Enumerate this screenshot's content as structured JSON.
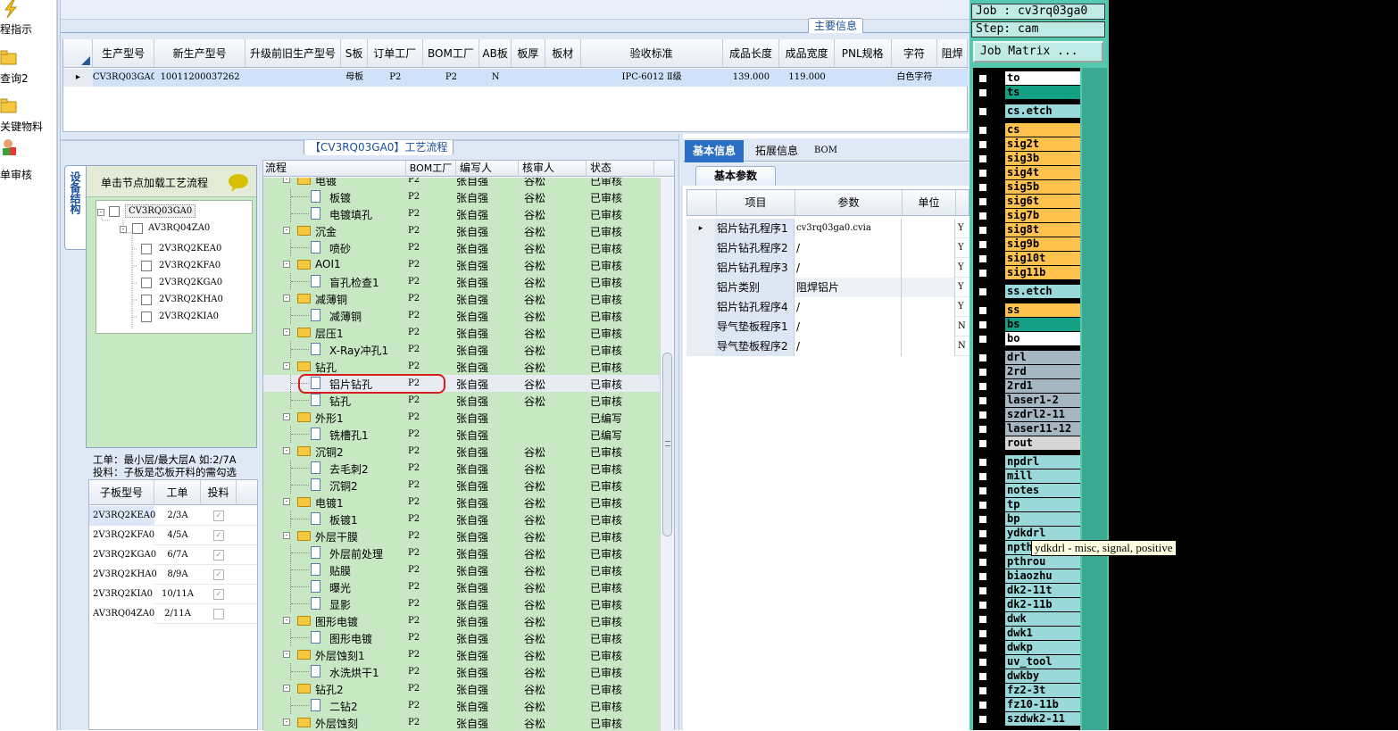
{
  "left_nav": {
    "items": [
      {
        "label": "程指示"
      },
      {
        "label": "查询2"
      },
      {
        "label": "关键物料"
      },
      {
        "label": "单审核"
      }
    ]
  },
  "top_panel": {
    "title": "主要信息",
    "columns": [
      "生产型号",
      "新生产型号",
      "升级前旧生产型号",
      "S板",
      "订单工厂",
      "BOM工厂",
      "AB板",
      "板厚",
      "板材",
      "验收标准",
      "成品长度",
      "成品宽度",
      "PNL规格",
      "字符",
      "阻焊"
    ],
    "row": [
      "CV3RQ03GA0",
      "10011200037262",
      "",
      "母板",
      "P2",
      "P2",
      "N",
      "",
      "",
      "IPC-6012 Ⅱ级",
      "139.000",
      "119.000",
      "",
      "白色字符",
      ""
    ]
  },
  "flow_panel": {
    "title": "【CV3RQ03GA0】工艺流程",
    "side_tab": "设备结构"
  },
  "node_panel": {
    "hint": "单击节点加载工艺流程",
    "tree": [
      "CV3RQ03GA0",
      "AV3RQ04ZA0",
      "2V3RQ2KEA0",
      "2V3RQ2KFA0",
      "2V3RQ2KGA0",
      "2V3RQ2KHA0",
      "2V3RQ2KIA0"
    ],
    "note1": "工单：最小层/最大层A 如:2/7A",
    "note2": "投料：子板是芯板开料的需勾选"
  },
  "sub_table": {
    "columns": [
      "子板型号",
      "工单",
      "投料"
    ],
    "rows": [
      [
        "2V3RQ2KEA0",
        "2/3A",
        true
      ],
      [
        "2V3RQ2KFA0",
        "4/5A",
        true
      ],
      [
        "2V3RQ2KGA0",
        "6/7A",
        true
      ],
      [
        "2V3RQ2KHA0",
        "8/9A",
        true
      ],
      [
        "2V3RQ2KIA0",
        "10/11A",
        true
      ],
      [
        "AV3RQ04ZA0",
        "2/11A",
        false
      ]
    ]
  },
  "flow_grid": {
    "columns": [
      "流程",
      "BOM工厂",
      "编写人",
      "核审人",
      "状态"
    ],
    "rows": [
      {
        "name": "电镀",
        "type": "folder",
        "bom": "P2",
        "writer": "张自强",
        "checker": "谷松",
        "status": "已审核"
      },
      {
        "name": "板镀",
        "type": "doc",
        "bom": "P2",
        "writer": "张自强",
        "checker": "谷松",
        "status": "已审核"
      },
      {
        "name": "电镀填孔",
        "type": "doc",
        "bom": "P2",
        "writer": "张自强",
        "checker": "谷松",
        "status": "已审核"
      },
      {
        "name": "沉金",
        "type": "folder",
        "bom": "P2",
        "writer": "张自强",
        "checker": "谷松",
        "status": "已审核"
      },
      {
        "name": "喷砂",
        "type": "doc",
        "bom": "P2",
        "writer": "张自强",
        "checker": "谷松",
        "status": "已审核"
      },
      {
        "name": "AOI1",
        "type": "folder",
        "bom": "P2",
        "writer": "张自强",
        "checker": "谷松",
        "status": "已审核"
      },
      {
        "name": "盲孔检查1",
        "type": "doc",
        "bom": "P2",
        "writer": "张自强",
        "checker": "谷松",
        "status": "已审核"
      },
      {
        "name": "减薄铜",
        "type": "folder",
        "bom": "P2",
        "writer": "张自强",
        "checker": "谷松",
        "status": "已审核"
      },
      {
        "name": "减薄铜",
        "type": "doc",
        "bom": "P2",
        "writer": "张自强",
        "checker": "谷松",
        "status": "已审核"
      },
      {
        "name": "层压1",
        "type": "folder",
        "bom": "P2",
        "writer": "张自强",
        "checker": "谷松",
        "status": "已审核"
      },
      {
        "name": "X-Ray冲孔1",
        "type": "doc",
        "bom": "P2",
        "writer": "张自强",
        "checker": "谷松",
        "status": "已审核"
      },
      {
        "name": "钻孔",
        "type": "folder",
        "bom": "P2",
        "writer": "张自强",
        "checker": "谷松",
        "status": "已审核"
      },
      {
        "name": "铝片钻孔",
        "type": "doc",
        "bom": "P2",
        "writer": "张自强",
        "checker": "谷松",
        "status": "已审核",
        "selected": true
      },
      {
        "name": "钻孔",
        "type": "doc",
        "bom": "P2",
        "writer": "张自强",
        "checker": "谷松",
        "status": "已审核"
      },
      {
        "name": "外形1",
        "type": "folder",
        "bom": "P2",
        "writer": "张自强",
        "checker": "",
        "status": "已编写"
      },
      {
        "name": "铣槽孔1",
        "type": "doc",
        "bom": "P2",
        "writer": "张自强",
        "checker": "",
        "status": "已编写"
      },
      {
        "name": "沉铜2",
        "type": "folder",
        "bom": "P2",
        "writer": "张自强",
        "checker": "谷松",
        "status": "已审核"
      },
      {
        "name": "去毛刺2",
        "type": "doc",
        "bom": "P2",
        "writer": "张自强",
        "checker": "谷松",
        "status": "已审核"
      },
      {
        "name": "沉铜2",
        "type": "doc",
        "bom": "P2",
        "writer": "张自强",
        "checker": "谷松",
        "status": "已审核"
      },
      {
        "name": "电镀1",
        "type": "folder",
        "bom": "P2",
        "writer": "张自强",
        "checker": "谷松",
        "status": "已审核"
      },
      {
        "name": "板镀1",
        "type": "doc",
        "bom": "P2",
        "writer": "张自强",
        "checker": "谷松",
        "status": "已审核"
      },
      {
        "name": "外层干膜",
        "type": "folder",
        "bom": "P2",
        "writer": "张自强",
        "checker": "谷松",
        "status": "已审核"
      },
      {
        "name": "外层前处理",
        "type": "doc",
        "bom": "P2",
        "writer": "张自强",
        "checker": "谷松",
        "status": "已审核"
      },
      {
        "name": "贴膜",
        "type": "doc",
        "bom": "P2",
        "writer": "张自强",
        "checker": "谷松",
        "status": "已审核"
      },
      {
        "name": "曝光",
        "type": "doc",
        "bom": "P2",
        "writer": "张自强",
        "checker": "谷松",
        "status": "已审核"
      },
      {
        "name": "显影",
        "type": "doc",
        "bom": "P2",
        "writer": "张自强",
        "checker": "谷松",
        "status": "已审核"
      },
      {
        "name": "图形电镀",
        "type": "folder",
        "bom": "P2",
        "writer": "张自强",
        "checker": "谷松",
        "status": "已审核"
      },
      {
        "name": "图形电镀",
        "type": "doc",
        "bom": "P2",
        "writer": "张自强",
        "checker": "谷松",
        "status": "已审核"
      },
      {
        "name": "外层蚀刻1",
        "type": "folder",
        "bom": "P2",
        "writer": "张自强",
        "checker": "谷松",
        "status": "已审核"
      },
      {
        "name": "水洗烘干1",
        "type": "doc",
        "bom": "P2",
        "writer": "张自强",
        "checker": "谷松",
        "status": "已审核"
      },
      {
        "name": "钻孔2",
        "type": "folder",
        "bom": "P2",
        "writer": "张自强",
        "checker": "谷松",
        "status": "已审核"
      },
      {
        "name": "二钻2",
        "type": "doc",
        "bom": "P2",
        "writer": "张自强",
        "checker": "谷松",
        "status": "已审核"
      },
      {
        "name": "外层蚀刻",
        "type": "folder",
        "bom": "P2",
        "writer": "张自强",
        "checker": "谷松",
        "status": "已审核"
      }
    ]
  },
  "info_panel": {
    "tabs": [
      "基本信息",
      "拓展信息",
      "BOM"
    ],
    "subtab": "基本参数",
    "columns": [
      "项目",
      "参数",
      "单位"
    ],
    "rows": [
      [
        "铝片钻孔程序1",
        "cv3rq03ga0.cvia",
        "",
        "Y"
      ],
      [
        "铝片钻孔程序2",
        "/",
        "",
        "Y"
      ],
      [
        "铝片钻孔程序3",
        "/",
        "",
        "Y"
      ],
      [
        "铝片类别",
        "阻焊铝片",
        "",
        "Y"
      ],
      [
        "铝片钻孔程序4",
        "/",
        "",
        "Y"
      ],
      [
        "导气垫板程序1",
        "/",
        "",
        "N"
      ],
      [
        "导气垫板程序2",
        "/",
        "",
        "N"
      ]
    ]
  },
  "job_matrix": {
    "job": "Job : cv3rq03ga0",
    "step": "Step: cam",
    "button": "Job Matrix ...",
    "layers": [
      {
        "name": "to",
        "color": "#ffffff"
      },
      {
        "name": "ts",
        "color": "#14a082"
      },
      {
        "name": "cs.etch",
        "color": "#9ad8da"
      },
      {
        "name": "cs",
        "color": "#ffc34d"
      },
      {
        "name": "sig2t",
        "color": "#ffc34d"
      },
      {
        "name": "sig3b",
        "color": "#ffc34d"
      },
      {
        "name": "sig4t",
        "color": "#ffc34d"
      },
      {
        "name": "sig5b",
        "color": "#ffc34d"
      },
      {
        "name": "sig6t",
        "color": "#ffc34d"
      },
      {
        "name": "sig7b",
        "color": "#ffc34d"
      },
      {
        "name": "sig8t",
        "color": "#ffc34d"
      },
      {
        "name": "sig9b",
        "color": "#ffc34d"
      },
      {
        "name": "sig10t",
        "color": "#ffc34d"
      },
      {
        "name": "sig11b",
        "color": "#ffc34d"
      },
      {
        "name": "ss.etch",
        "color": "#9ad8da"
      },
      {
        "name": "ss",
        "color": "#ffc34d"
      },
      {
        "name": "bs",
        "color": "#14a082"
      },
      {
        "name": "bo",
        "color": "#ffffff"
      },
      {
        "name": "drl",
        "color": "#a6b7c2"
      },
      {
        "name": "2rd",
        "color": "#a6b7c2"
      },
      {
        "name": "2rd1",
        "color": "#a6b7c2"
      },
      {
        "name": "laser1-2",
        "color": "#a6b7c2"
      },
      {
        "name": "szdrl2-11",
        "color": "#a6b7c2"
      },
      {
        "name": "laser11-12",
        "color": "#a6b7c2"
      },
      {
        "name": "rout",
        "color": "#d7d7d7"
      },
      {
        "name": "npdrl",
        "color": "#9ad8da"
      },
      {
        "name": "mill",
        "color": "#9ad8da"
      },
      {
        "name": "notes",
        "color": "#9ad8da"
      },
      {
        "name": "tp",
        "color": "#9ad8da"
      },
      {
        "name": "bp",
        "color": "#9ad8da"
      },
      {
        "name": "ydkdrl",
        "color": "#9ad8da"
      },
      {
        "name": "npth",
        "color": "#9ad8da"
      },
      {
        "name": "pthrou",
        "color": "#9ad8da"
      },
      {
        "name": "biaozhu",
        "color": "#9ad8da"
      },
      {
        "name": "dk2-11t",
        "color": "#9ad8da"
      },
      {
        "name": "dk2-11b",
        "color": "#9ad8da"
      },
      {
        "name": "dwk",
        "color": "#9ad8da"
      },
      {
        "name": "dwk1",
        "color": "#9ad8da"
      },
      {
        "name": "dwkp",
        "color": "#9ad8da"
      },
      {
        "name": "uv_tool",
        "color": "#9ad8da"
      },
      {
        "name": "dwkby",
        "color": "#9ad8da"
      },
      {
        "name": "fz2-3t",
        "color": "#9ad8da"
      },
      {
        "name": "fz10-11b",
        "color": "#9ad8da"
      },
      {
        "name": "szdwk2-11",
        "color": "#9ad8da"
      }
    ],
    "tooltip": "ydkdrl - misc, signal, positive"
  }
}
